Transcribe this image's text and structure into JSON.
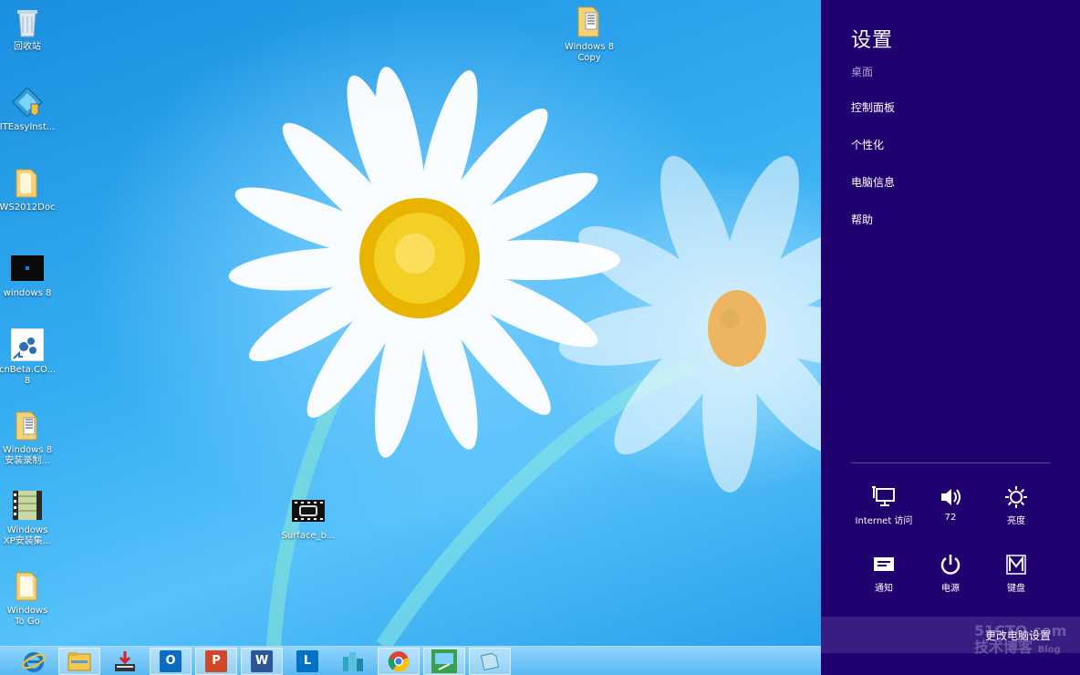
{
  "desktop": {
    "icons": [
      {
        "label": "回收站"
      },
      {
        "label": "ITEasyInst..."
      },
      {
        "label": "WS2012Doc"
      },
      {
        "label": "windows 8"
      },
      {
        "label": "cnBeta.CO...\n8"
      },
      {
        "label": "Windows 8\n安装录制..."
      },
      {
        "label": "Windows\nXP安装集..."
      },
      {
        "label": "Windows\nTo Go"
      },
      {
        "label": "Windows 8\nCopy"
      },
      {
        "label": "Surface_b..."
      }
    ]
  },
  "taskbar": {
    "items": [
      {
        "name": "internet-explorer",
        "glyph": "e",
        "color": "#1e73c8"
      },
      {
        "name": "file-explorer",
        "glyph": "",
        "color": "#f2c94c"
      },
      {
        "name": "download-tool",
        "glyph": "",
        "color": "#d33"
      },
      {
        "name": "outlook",
        "glyph": "O",
        "color": "#0b6cc1"
      },
      {
        "name": "powerpoint",
        "glyph": "P",
        "color": "#d24726"
      },
      {
        "name": "word",
        "glyph": "W",
        "color": "#2b579a"
      },
      {
        "name": "lync",
        "glyph": "L",
        "color": "#0072c6"
      },
      {
        "name": "city-app",
        "glyph": "",
        "color": "#2ea5c4"
      },
      {
        "name": "chrome",
        "glyph": "",
        "color": "#e34133"
      },
      {
        "name": "remote-desktop",
        "glyph": "",
        "color": "#3aa04a"
      },
      {
        "name": "notes-app",
        "glyph": "",
        "color": "#6aa8c8"
      }
    ]
  },
  "charm": {
    "title": "设置",
    "context": "桌面",
    "menu": [
      "控制面板",
      "个性化",
      "电脑信息",
      "帮助"
    ],
    "tiles": [
      {
        "label": "Internet 访问",
        "icon": "network-icon"
      },
      {
        "label": "72",
        "icon": "volume-icon"
      },
      {
        "label": "亮度",
        "icon": "brightness-icon"
      },
      {
        "label": "通知",
        "icon": "notifications-icon"
      },
      {
        "label": "电源",
        "icon": "power-icon"
      },
      {
        "label": "键盘",
        "icon": "keyboard-icon"
      }
    ],
    "change_settings": "更改电脑设置",
    "watermark_line1": "51CTO.com",
    "watermark_line2": "技术博客",
    "watermark_line3": "Blog"
  },
  "colors": {
    "charm_bg": "#21006f",
    "charm_footer": "#3a1d82"
  }
}
